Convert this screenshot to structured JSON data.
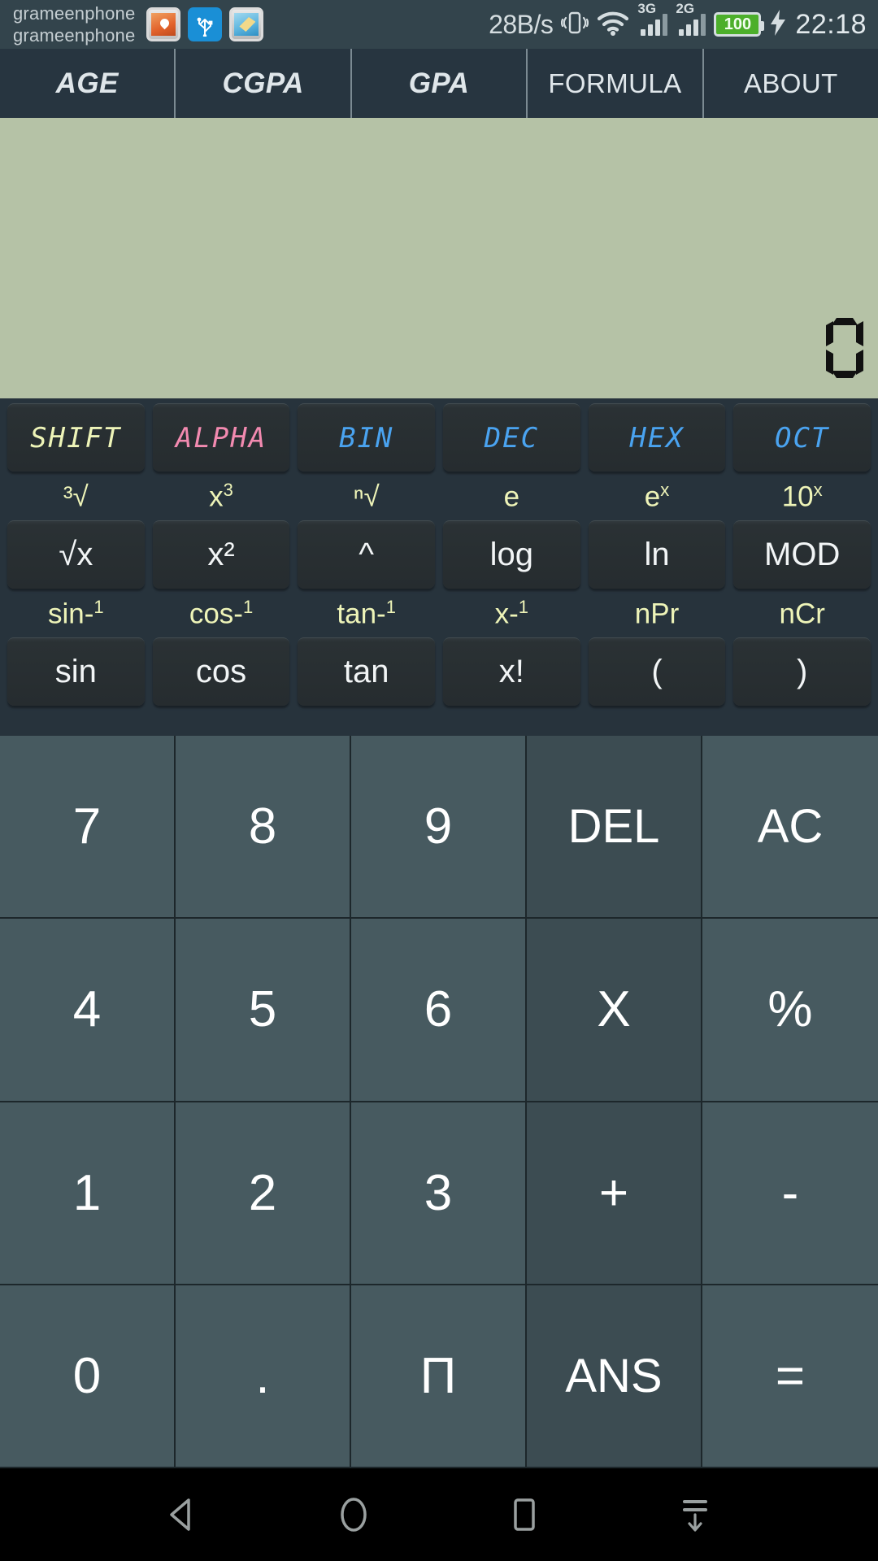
{
  "status_bar": {
    "carrier_line1": "grameenphone",
    "carrier_line2": "grameenphone",
    "notification_icons": [
      "photo-health-icon",
      "usb-icon",
      "cleaner-icon"
    ],
    "network_speed": "28B/s",
    "vibrate_icon": "vibrate-icon",
    "wifi_icon": "wifi-icon",
    "signal_1_label": "3G",
    "signal_2_label": "2G",
    "battery_level": "100",
    "charging_icon": "charging-bolt-icon",
    "time": "22:18",
    "battery_color": "#4caf2b"
  },
  "tabs": [
    {
      "label": "AGE",
      "emphasis": true
    },
    {
      "label": "CGPA",
      "emphasis": true
    },
    {
      "label": "GPA",
      "emphasis": true
    },
    {
      "label": "FORMULA",
      "emphasis": false
    },
    {
      "label": "ABOUT",
      "emphasis": false
    }
  ],
  "display": {
    "value": "0",
    "background_color": "#b5c2a6",
    "digit_color": "#111111"
  },
  "sci_panel": {
    "background_color": "#27333c",
    "rows": [
      {
        "shift_labels": [],
        "buttons": [
          {
            "label": "SHIFT",
            "style": "lcd yellow"
          },
          {
            "label": "ALPHA",
            "style": "lcd pink"
          },
          {
            "label": "BIN",
            "style": "lcd blue"
          },
          {
            "label": "DEC",
            "style": "lcd blue"
          },
          {
            "label": "HEX",
            "style": "lcd blue"
          },
          {
            "label": "OCT",
            "style": "lcd blue"
          }
        ]
      },
      {
        "shift_labels": [
          {
            "base": "³√",
            "sup": ""
          },
          {
            "base": "x",
            "sup": "3"
          },
          {
            "base": "ⁿ√",
            "sup": ""
          },
          {
            "base": "e",
            "sup": ""
          },
          {
            "base": "e",
            "sup": "x"
          },
          {
            "base": "10",
            "sup": "x"
          }
        ],
        "buttons": [
          {
            "label": "√x",
            "style": ""
          },
          {
            "label": "x²",
            "style": ""
          },
          {
            "label": "^",
            "style": ""
          },
          {
            "label": "log",
            "style": ""
          },
          {
            "label": "ln",
            "style": ""
          },
          {
            "label": "MOD",
            "style": ""
          }
        ]
      },
      {
        "shift_labels": [
          {
            "base": "sin-",
            "sup": "1"
          },
          {
            "base": "cos-",
            "sup": "1"
          },
          {
            "base": "tan-",
            "sup": "1"
          },
          {
            "base": "x-",
            "sup": "1"
          },
          {
            "base": "nPr",
            "sup": ""
          },
          {
            "base": "nCr",
            "sup": ""
          }
        ],
        "buttons": [
          {
            "label": "sin",
            "style": ""
          },
          {
            "label": "cos",
            "style": ""
          },
          {
            "label": "tan",
            "style": ""
          },
          {
            "label": "x!",
            "style": ""
          },
          {
            "label": "(",
            "style": ""
          },
          {
            "label": ")",
            "style": ""
          }
        ]
      }
    ]
  },
  "keypad": {
    "normal_key_color": "#475a60",
    "operator_key_color": "#3c4c52",
    "keys": [
      {
        "label": "7",
        "type": "digit"
      },
      {
        "label": "8",
        "type": "digit"
      },
      {
        "label": "9",
        "type": "digit"
      },
      {
        "label": "DEL",
        "type": "op"
      },
      {
        "label": "AC",
        "type": "op"
      },
      {
        "label": "4",
        "type": "digit"
      },
      {
        "label": "5",
        "type": "digit"
      },
      {
        "label": "6",
        "type": "digit"
      },
      {
        "label": "X",
        "type": "op"
      },
      {
        "label": "%",
        "type": "digit"
      },
      {
        "label": "1",
        "type": "digit"
      },
      {
        "label": "2",
        "type": "digit"
      },
      {
        "label": "3",
        "type": "digit"
      },
      {
        "label": "+",
        "type": "op"
      },
      {
        "label": "-",
        "type": "digit"
      },
      {
        "label": "0",
        "type": "digit"
      },
      {
        "label": ".",
        "type": "digit"
      },
      {
        "label": "Π",
        "type": "digit"
      },
      {
        "label": "ANS",
        "type": "op"
      },
      {
        "label": "=",
        "type": "digit"
      }
    ]
  },
  "nav_bar": {
    "items": [
      "back-icon",
      "home-icon",
      "recents-icon",
      "hide-navbar-icon"
    ]
  }
}
